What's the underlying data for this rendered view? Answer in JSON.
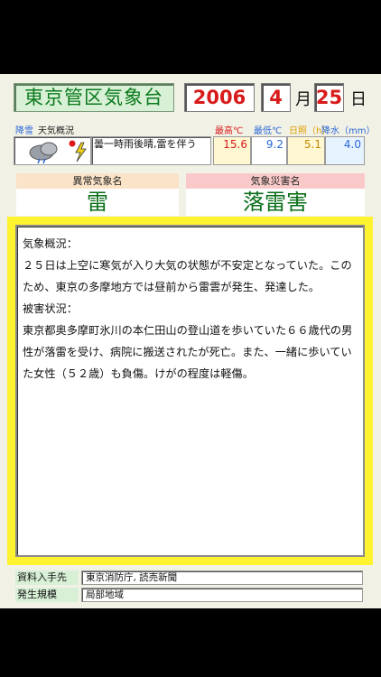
{
  "header": {
    "office": "東京管区気象台",
    "year": "2006",
    "month": "4",
    "month_unit": "月",
    "day": "25",
    "day_unit": "日"
  },
  "weather_labels": {
    "precip": "降雪",
    "summary": "天気概況",
    "max_temp": "最高℃",
    "min_temp": "最低℃",
    "sunshine": "日照（h)",
    "precipitation": "降水（mm）"
  },
  "weather": {
    "summary": "曇一時雨後晴,雷を伴う",
    "max_temp": "15.6",
    "min_temp": "9.2",
    "sunshine": "5.1",
    "precipitation": "4.0"
  },
  "phenomenon": {
    "label": "異常気象名",
    "value": "雷"
  },
  "disaster": {
    "label": "気象災害名",
    "value": "落雷害"
  },
  "report": {
    "heading1": "気象概況：",
    "para1": "２５日は上空に寒気が入り大気の状態が不安定となっていた。このため、東京の多摩地方では昼前から雷雲が発生、発達した。",
    "heading2": "被害状況：",
    "para2": "東京都奥多摩町氷川の本仁田山の登山道を歩いていた６６歳代の男性が落雷を受け、病院に搬送されたが死亡。また、一緒に歩いていた女性（５２歳）も負傷。けがの程度は軽傷。"
  },
  "footer": {
    "source_label": "資料入手先",
    "source_value": "東京消防庁, 読売新聞",
    "scale_label": "発生規模",
    "scale_value": "局部地域"
  },
  "colors": {
    "office_green": "#0a7a1c",
    "date_red": "#d81a1a",
    "report_border_yellow": "#fff22e"
  },
  "icons": [
    "cloud-rain-lightning-icon",
    "red-dot-icon",
    "lightning-bolt-icon"
  ]
}
